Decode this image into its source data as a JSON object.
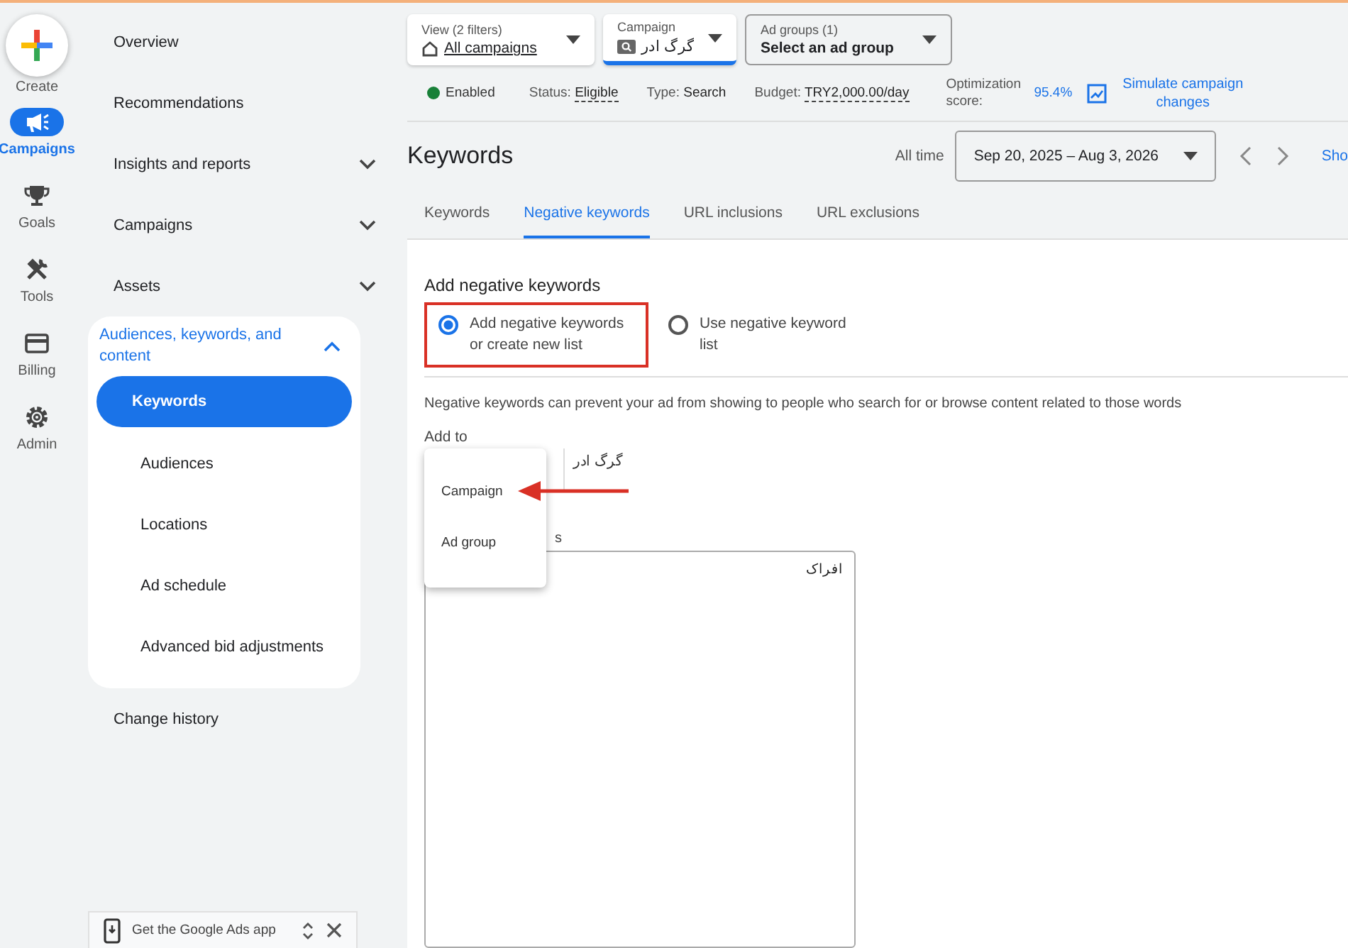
{
  "rail": [
    {
      "kind": "create",
      "label": "Create",
      "selected": false
    },
    {
      "kind": "campaigns",
      "label": "Campaigns",
      "selected": true
    },
    {
      "kind": "goals",
      "label": "Goals",
      "selected": false
    },
    {
      "kind": "tools",
      "label": "Tools",
      "selected": false
    },
    {
      "kind": "billing",
      "label": "Billing",
      "selected": false
    },
    {
      "kind": "admin",
      "label": "Admin",
      "selected": false
    }
  ],
  "nav": [
    {
      "kind": "link",
      "label": "Overview"
    },
    {
      "kind": "link",
      "label": "Recommendations"
    },
    {
      "kind": "group",
      "label": "Insights and reports",
      "expanded": false
    },
    {
      "kind": "group",
      "label": "Campaigns",
      "expanded": false
    },
    {
      "kind": "group",
      "label": "Assets",
      "expanded": false
    },
    {
      "kind": "group",
      "label": "Audiences, keywords, and content",
      "expanded": true,
      "children": [
        {
          "label": "Keywords",
          "selected": true
        },
        {
          "label": "Audiences",
          "selected": false
        },
        {
          "label": "Locations",
          "selected": false
        },
        {
          "label": "Ad schedule",
          "selected": false
        },
        {
          "label": "Advanced bid adjustments",
          "selected": false
        }
      ]
    },
    {
      "kind": "link",
      "label": "Change history"
    }
  ],
  "app_banner": {
    "label": "Get the Google Ads app"
  },
  "filters": [
    {
      "kind": "view",
      "label": "View (2 filters)",
      "value": "All campaigns"
    },
    {
      "kind": "campaign",
      "label": "Campaign",
      "value": "گرگ ادر"
    },
    {
      "kind": "adgroup",
      "label": "Ad groups (1)",
      "value": "Select an ad group"
    }
  ],
  "status_row": {
    "state": "Enabled",
    "status_label": "Status:",
    "status_value": "Eligible",
    "type_label": "Type:",
    "type_value": "Search",
    "budget_label": "Budget:",
    "budget_value": "TRY2,000.00/day",
    "optimization_label": "Optimization score:",
    "optimization_value": "95.4%",
    "simulate": "Simulate campaign changes"
  },
  "page_title": "Keywords",
  "date_range": {
    "label": "All time",
    "value": "Sep 20, 2025 – Aug 3, 2026"
  },
  "show_link": "Sho",
  "tabs": [
    {
      "label": "Keywords",
      "selected": false
    },
    {
      "label": "Negative keywords",
      "selected": true
    },
    {
      "label": "URL inclusions",
      "selected": false
    },
    {
      "label": "URL exclusions",
      "selected": false
    }
  ],
  "form": {
    "heading": "Add negative keywords",
    "options": [
      {
        "label": "Add negative keywords or create new list",
        "selected": true,
        "highlighted": true
      },
      {
        "label": "Use negative keyword list",
        "selected": false,
        "highlighted": false
      }
    ],
    "description": "Negative keywords can prevent your ad from showing to people who search for or browse content related to those words",
    "add_to_label": "Add to",
    "menu": [
      {
        "label": "Campaign",
        "pointed": true
      },
      {
        "label": "Ad group",
        "pointed": false
      }
    ],
    "campaign_name": "گرگ ادر",
    "keywords_label": "s",
    "keywords_value": "افراک"
  }
}
